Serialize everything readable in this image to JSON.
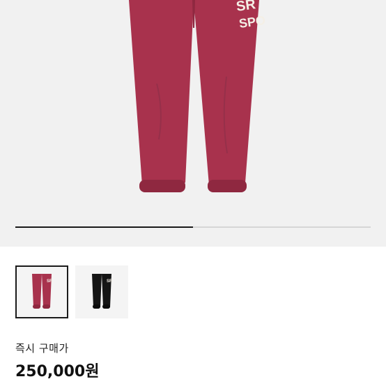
{
  "colors": {
    "pants_primary": "#a8324d",
    "pants_shadow": "#8f2840",
    "pants_black": "#151515",
    "logo_text": "#f4efe6",
    "gallery_bg": "#f1f1f1"
  },
  "hero": {
    "logo_line1": "SR",
    "logo_line2": "SPO"
  },
  "gallery_progress": 0.5,
  "thumbnails": [
    {
      "name": "burgundy",
      "selected": true
    },
    {
      "name": "black",
      "selected": false
    }
  ],
  "purchase": {
    "label": "즉시 구매가",
    "price": "250,000원"
  }
}
